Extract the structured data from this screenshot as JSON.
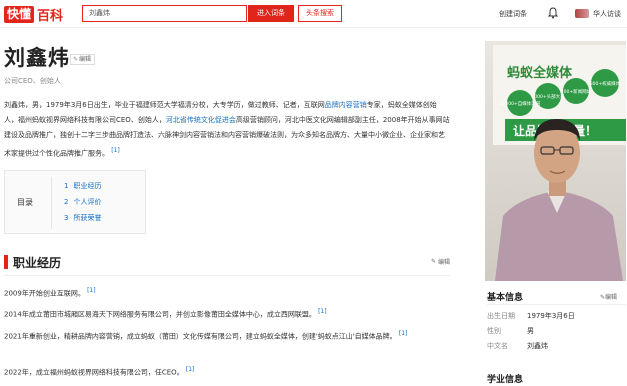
{
  "header": {
    "logo_mark": "快懂",
    "logo_text": "百科",
    "search_value": "刘鑫炜",
    "enter_button": "进入词条",
    "toutiao_button": "头条搜索",
    "create_link": "创建词条",
    "user_name": "华人访谈"
  },
  "page": {
    "title": "刘鑫炜",
    "edit_label": "编辑",
    "subtitle": "公司CEO、创始人"
  },
  "summary": {
    "part1": "刘鑫炜，男，1979年3月6日出生，毕业于福建师范大学福清分校，大专学历，做过教师、记者，互联网",
    "link1": "品牌内容营销",
    "part2": "专家，蚂蚁全媒体创始人，福州蚂蚁视界网络科技有限公司CEO、创始人，",
    "link2": "河北省传统文化促进会",
    "part3": "高级营销顾问，河北中医文化网编辑部副主任，2008年开始从事网站建设及品牌推广，独创十二字三步曲品牌打造法、六脉神剑内容营销法和内容营销爆破法则，为众多知名品牌方、大量中小微企业、企业家和艺术家提供过个性化品牌推广服务。",
    "ref": "[1]"
  },
  "toc": {
    "title": "目录",
    "items": [
      {
        "num": "1",
        "label": "职业经历"
      },
      {
        "num": "2",
        "label": "个人评价"
      },
      {
        "num": "3",
        "label": "所获荣誉"
      }
    ]
  },
  "career": {
    "title": "职业经历",
    "edit_label": "编辑",
    "entries": [
      {
        "text": "2009年开始创业互联网。",
        "ref": "[1]"
      },
      {
        "text": "2014年成立莆田市城厢区易海天下网络服务有限公司，并创立影像莆田全媒体中心，成立西网联盟。",
        "ref": "[1]"
      },
      {
        "text": "2021年重新创业，精耕品牌内容营销，成立蚂蚁（莆田）文化传媒有限公司，建立蚂蚁全媒体，创建'蚂蚁点江山'自媒体品牌。",
        "ref": "[1]"
      },
      {
        "text": "2022年，成立福州蚂蚁视界网络科技有限公司，任CEO。",
        "ref": "[1]"
      }
    ]
  },
  "photo": {
    "banner_top": "蚂蚁全媒体",
    "badges": [
      "12000+自媒体渠道",
      "3000+头部大号",
      "400+新闻网站",
      "300+权威媒体"
    ],
    "slogan": "让品牌有力量！"
  },
  "info": {
    "title": "基本信息",
    "edit_label": "编辑",
    "rows": [
      {
        "k": "出生日期",
        "v": "1979年3月6日"
      },
      {
        "k": "性别",
        "v": "男"
      },
      {
        "k": "中文名",
        "v": "刘鑫炜"
      }
    ],
    "learn_title": "学业信息"
  },
  "colors": {
    "brand_red": "#e0261b",
    "link_blue": "#136ec2"
  }
}
